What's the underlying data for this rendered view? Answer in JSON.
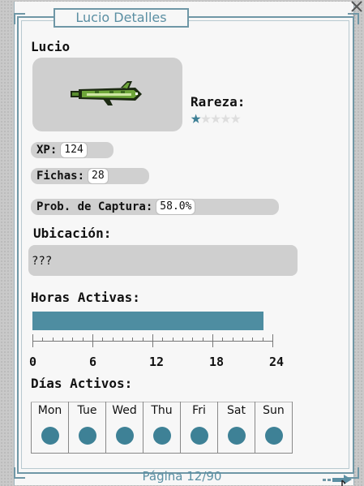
{
  "window": {
    "title": "Lucio Detalles"
  },
  "fish": {
    "name": "Lucio",
    "icon": "pike-fish-icon",
    "rarity_label": "Rareza:",
    "rarity_stars": 1,
    "rarity_max": 5
  },
  "stats": {
    "xp_label": "XP:",
    "xp_value": "124",
    "tokens_label": "Fichas:",
    "tokens_value": "28",
    "catch_label": "Prob. de Captura:",
    "catch_value": "58.0%"
  },
  "location": {
    "label": "Ubicación:",
    "value": "???"
  },
  "hours": {
    "label": "Horas Activas:",
    "range_start": 0,
    "range_end": 23,
    "axis_max": 24,
    "ticks": [
      "0",
      "6",
      "12",
      "18",
      "24"
    ]
  },
  "days": {
    "label": "Días Activos:",
    "names": [
      "Mon",
      "Tue",
      "Wed",
      "Thu",
      "Fri",
      "Sat",
      "Sun"
    ],
    "active": [
      true,
      true,
      true,
      true,
      true,
      true,
      true
    ]
  },
  "footer": {
    "page": "Página 12/90",
    "next_icon": "next-arrow-icon"
  },
  "colors": {
    "accent": "#4e8da1",
    "frame": "#6f97a6",
    "box": "#cfcfcf"
  }
}
